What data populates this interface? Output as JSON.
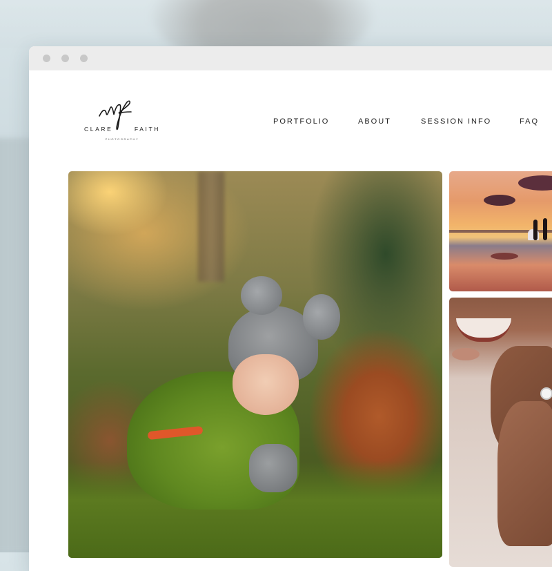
{
  "site": {
    "logo_first": "CLARE",
    "logo_last": "FAITH",
    "logo_subtitle": "PHOTOGRAPHY"
  },
  "nav": {
    "items": [
      "PORTFOLIO",
      "ABOUT",
      "SESSION INFO",
      "FAQ"
    ]
  },
  "gallery": {
    "photos": [
      {
        "subject": "child in knit hat in forest ferns"
      },
      {
        "subject": "couple silhouette at sunset beach"
      },
      {
        "subject": "hands with engagement ring"
      }
    ]
  },
  "colors": {
    "page_background": "#ffffff",
    "browser_bar": "#ececec",
    "nav_text": "#222222"
  }
}
